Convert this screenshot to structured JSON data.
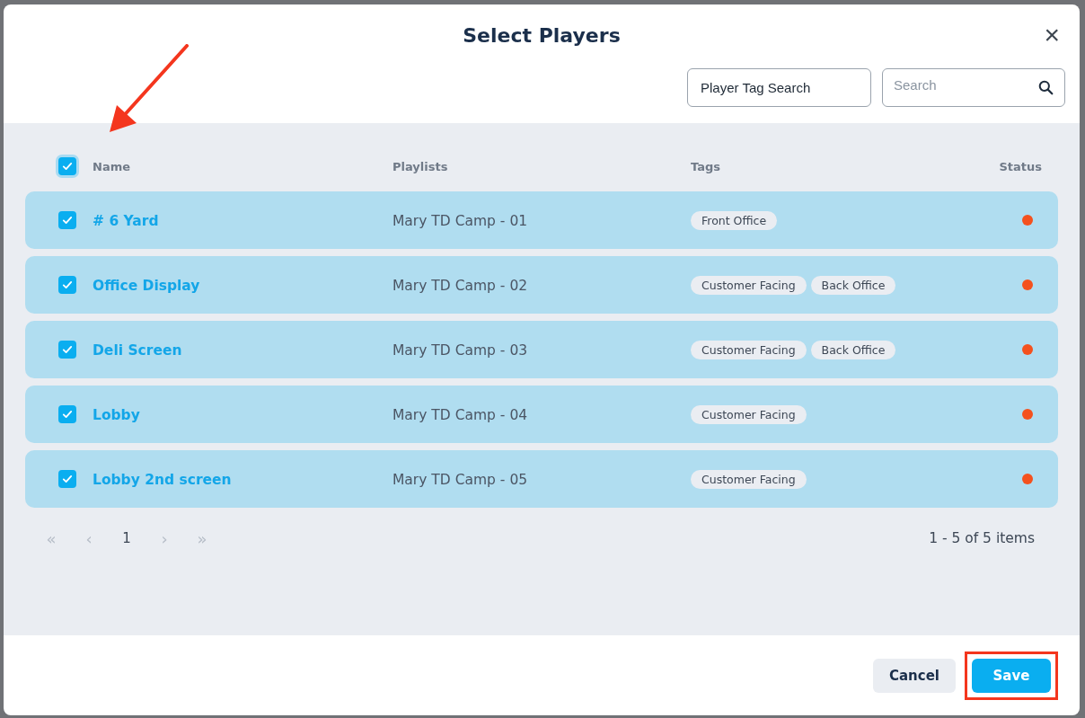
{
  "dialog": {
    "title": "Select Players",
    "close": "×"
  },
  "filters": {
    "tag_search": {
      "value": "Player Tag Search"
    },
    "search": {
      "placeholder": "Search"
    }
  },
  "table": {
    "select_all": {
      "checked": true
    },
    "columns": [
      "Name",
      "Playlists",
      "Tags",
      "Status"
    ],
    "rows": [
      {
        "checked": true,
        "name": "# 6 Yard",
        "playlist": "Mary TD Camp - 01",
        "tags": [
          "Front Office"
        ],
        "color": "#f4511e"
      },
      {
        "checked": true,
        "name": "Office Display",
        "playlist": "Mary TD Camp - 02",
        "tags": [
          "Customer Facing",
          "Back Office"
        ],
        "color": "#f4511e"
      },
      {
        "checked": true,
        "name": "Deli Screen",
        "playlist": "Mary TD Camp - 03",
        "tags": [
          "Customer Facing",
          "Back Office"
        ],
        "color": "#f4511e"
      },
      {
        "checked": true,
        "name": "Lobby",
        "playlist": "Mary TD Camp - 04",
        "tags": [
          "Customer Facing"
        ],
        "color": "#f4511e"
      },
      {
        "checked": true,
        "name": "Lobby 2nd screen",
        "playlist": "Mary TD Camp - 05",
        "tags": [
          "Customer Facing"
        ],
        "color": "#f4511e"
      }
    ]
  },
  "pagination": {
    "controls": [
      {
        "kind": "first",
        "label": "«"
      },
      {
        "kind": "prev",
        "label": "‹"
      },
      {
        "kind": "page",
        "label": "1"
      },
      {
        "kind": "next",
        "label": "›"
      },
      {
        "kind": "last",
        "label": "»"
      }
    ],
    "summary": "1 - 5 of 5 items"
  },
  "buttons": [
    {
      "kind": "secondary",
      "label": "Cancel",
      "highlighted": false
    },
    {
      "kind": "primary",
      "label": "Save",
      "highlighted": true
    }
  ],
  "annotations": {
    "arrow": true
  }
}
